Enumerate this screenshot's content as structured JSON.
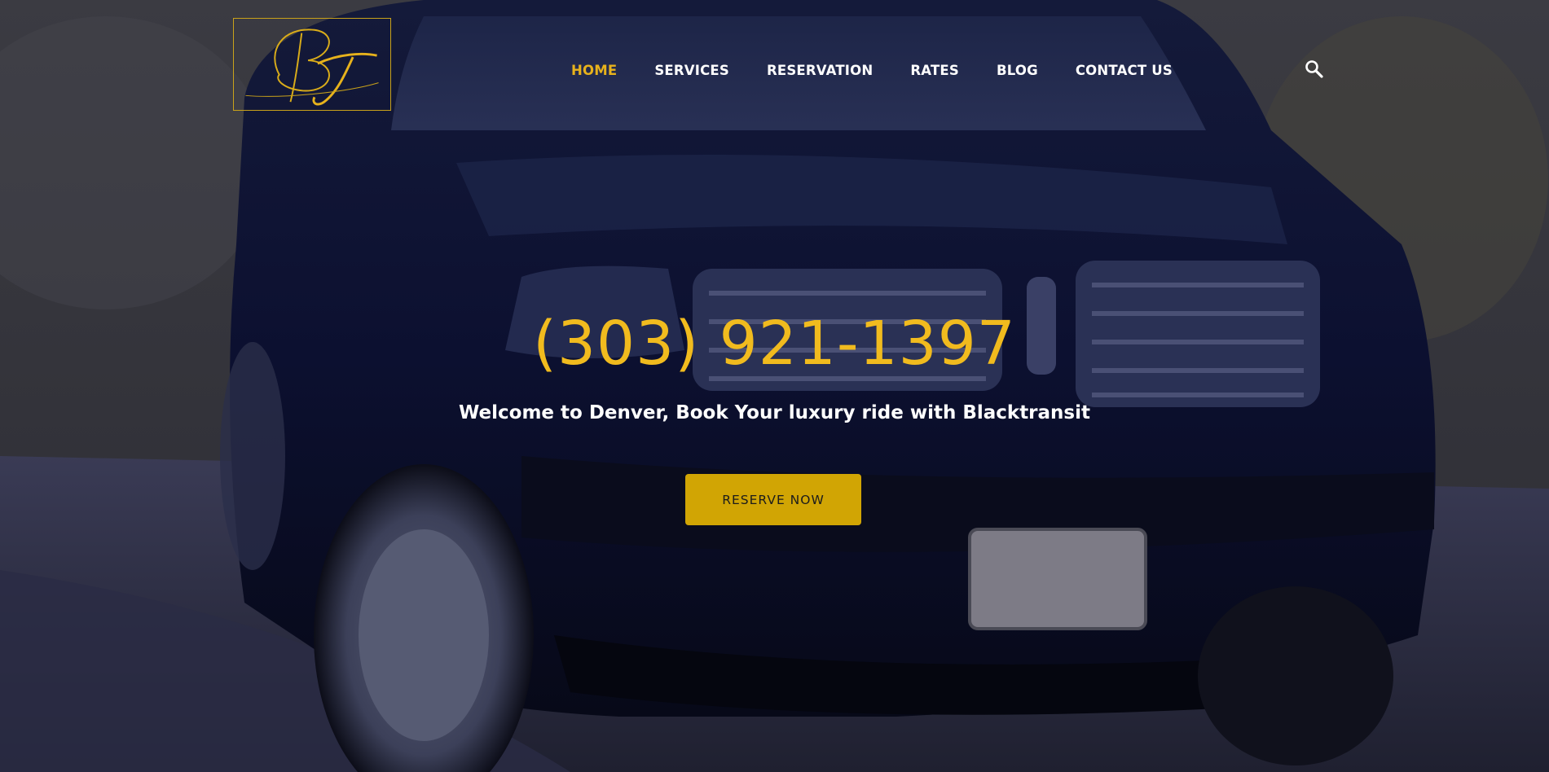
{
  "brand": {
    "logo_monogram": "BT",
    "accent_color": "#e7b21c",
    "button_color": "#d1a504"
  },
  "nav": {
    "items": [
      {
        "label": "HOME",
        "active": true
      },
      {
        "label": "SERVICES",
        "active": false
      },
      {
        "label": "RESERVATION",
        "active": false
      },
      {
        "label": "RATES",
        "active": false
      },
      {
        "label": "BLOG",
        "active": false
      },
      {
        "label": "CONTACT US",
        "active": false
      }
    ],
    "search_icon": "search-icon"
  },
  "hero": {
    "phone": "(303) 921-1397",
    "tagline": "Welcome to Denver, Book Your luxury ride with Blacktransit",
    "cta_label": "RESERVE NOW"
  }
}
